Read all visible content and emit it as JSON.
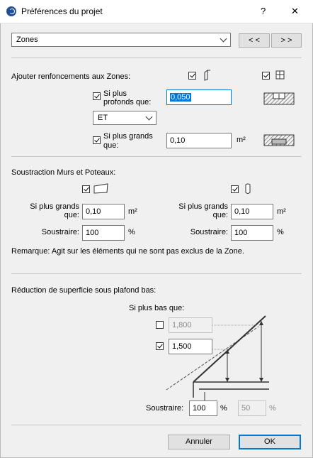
{
  "window": {
    "title": "Préférences du projet",
    "help": "?",
    "close": "✕"
  },
  "top": {
    "zones_select": "Zones",
    "prev_btn": "< <",
    "next_btn": "> >"
  },
  "recess": {
    "heading": "Ajouter renfoncements aux Zones:",
    "deeper_label_1": "Si plus",
    "deeper_label_2": "profonds que:",
    "deeper_value": "0,050",
    "logic_select": "ET",
    "larger_label_1": "Si plus grands",
    "larger_label_2": "que:",
    "larger_value": "0,10",
    "larger_unit": "m²"
  },
  "subtract": {
    "heading": "Soustraction Murs et Poteaux:",
    "left_label_1": "Si plus grands",
    "left_label_2": "que:",
    "left_value": "0,10",
    "left_unit": "m²",
    "left_sub_label": "Soustraire:",
    "left_sub_value": "100",
    "left_sub_unit": "%",
    "right_label_1": "Si plus grands",
    "right_label_2": "que:",
    "right_value": "0,10",
    "right_unit": "m²",
    "right_sub_label": "Soustraire:",
    "right_sub_value": "100",
    "right_sub_unit": "%",
    "remark": "Remarque: Agit sur les éléments qui ne sont pas exclus de la Zone."
  },
  "reduction": {
    "heading": "Réduction de superficie sous plafond bas:",
    "lower_label": "Si plus bas que:",
    "value_1": "1,800",
    "value_2": "1,500",
    "sub_label": "Soustraire:",
    "sub_value_1": "100",
    "sub_unit_1": "%",
    "sub_value_2": "50",
    "sub_unit_2": "%"
  },
  "footer": {
    "cancel": "Annuler",
    "ok": "OK"
  },
  "colors": {
    "accent": "#0078d7",
    "background": "#f0f0f0"
  }
}
